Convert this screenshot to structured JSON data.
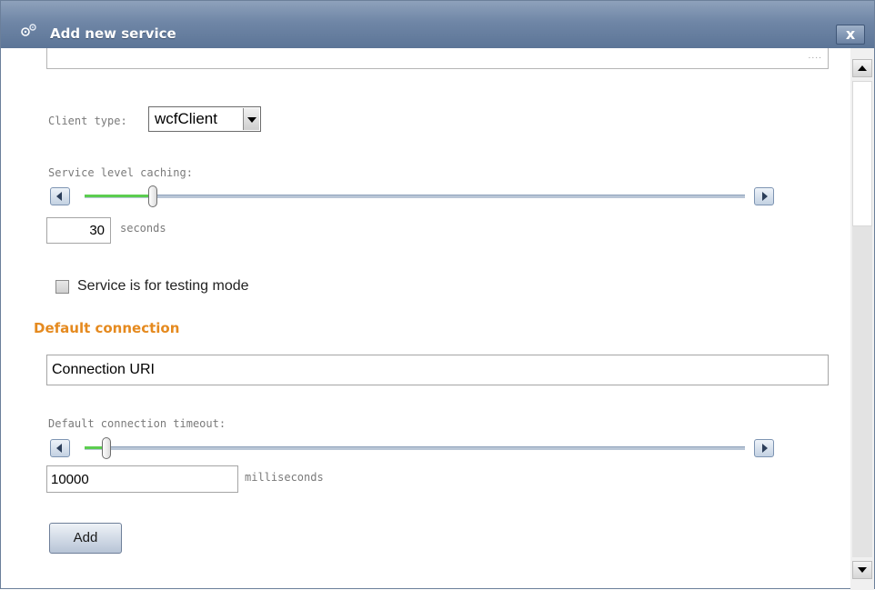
{
  "window": {
    "title": "Add new service",
    "icon": "gear-icon",
    "close_label": "x",
    "title_color": "#6f86a6"
  },
  "form": {
    "top_field_ellipsis": "....",
    "client_type_label": "Client type:",
    "client_type_value": "wcfClient",
    "caching_label": "Service level caching:",
    "caching_value": "30",
    "caching_unit": "seconds",
    "caching_slider_level": 0.1,
    "testing_mode_label": "Service is for testing mode",
    "testing_mode_checked": false,
    "section_title": "Default connection",
    "section_title_color": "#e58a1f",
    "connection_uri_value": "Connection URI",
    "timeout_label": "Default connection timeout:",
    "timeout_value": "10000",
    "timeout_unit": "milliseconds",
    "timeout_slider_level": 0.03,
    "add_button_label": "Add"
  },
  "accent": {
    "slider_fill": "#5ccd4f"
  }
}
